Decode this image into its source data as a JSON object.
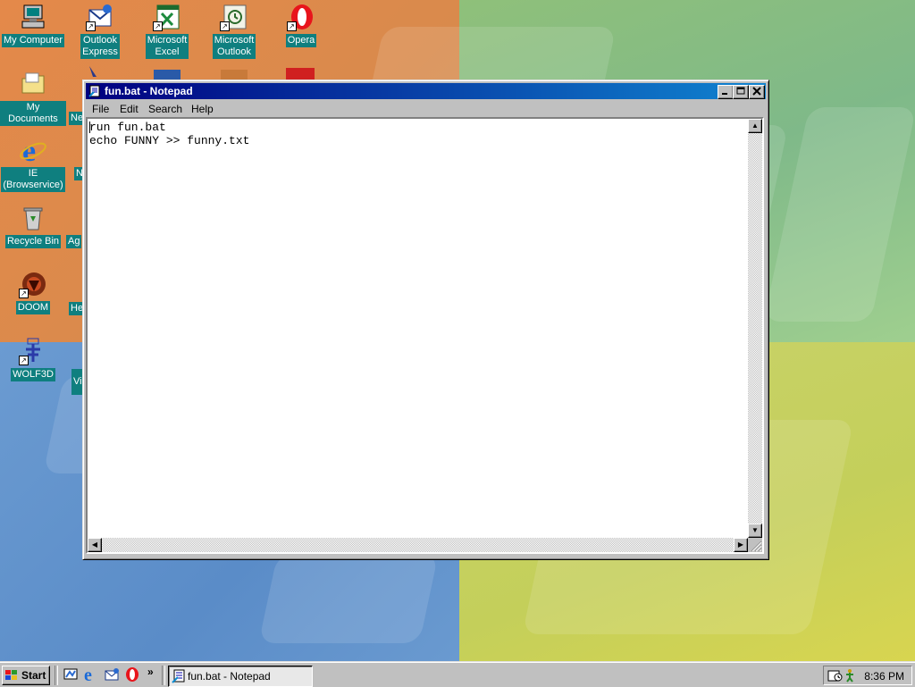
{
  "desktop": {
    "icons": [
      {
        "label": "My Computer"
      },
      {
        "label": "Outlook\nExpress"
      },
      {
        "label": "Microsoft\nExcel"
      },
      {
        "label": "Microsoft\nOutlook"
      },
      {
        "label": "Opera"
      },
      {
        "label": "My Documents"
      },
      {
        "label": "IE\n(Browservice)"
      },
      {
        "label": "Recycle Bin"
      },
      {
        "label": "DOOM"
      },
      {
        "label": "WOLF3D"
      }
    ],
    "partial_labels": [
      "Ne",
      "N",
      "Ag",
      "He",
      "Vi"
    ]
  },
  "notepad": {
    "title": "fun.bat - Notepad",
    "menu": [
      "File",
      "Edit",
      "Search",
      "Help"
    ],
    "content": "run fun.bat\necho FUNNY >> funny.txt"
  },
  "taskbar": {
    "start_label": "Start",
    "quick_launch_more": "»",
    "task_label": "fun.bat - Notepad",
    "clock": "8:36 PM"
  },
  "colors": {
    "title_bar": "#000080",
    "window_face": "#c0c0c0",
    "icon_label_bg": "#0f7f7f"
  }
}
